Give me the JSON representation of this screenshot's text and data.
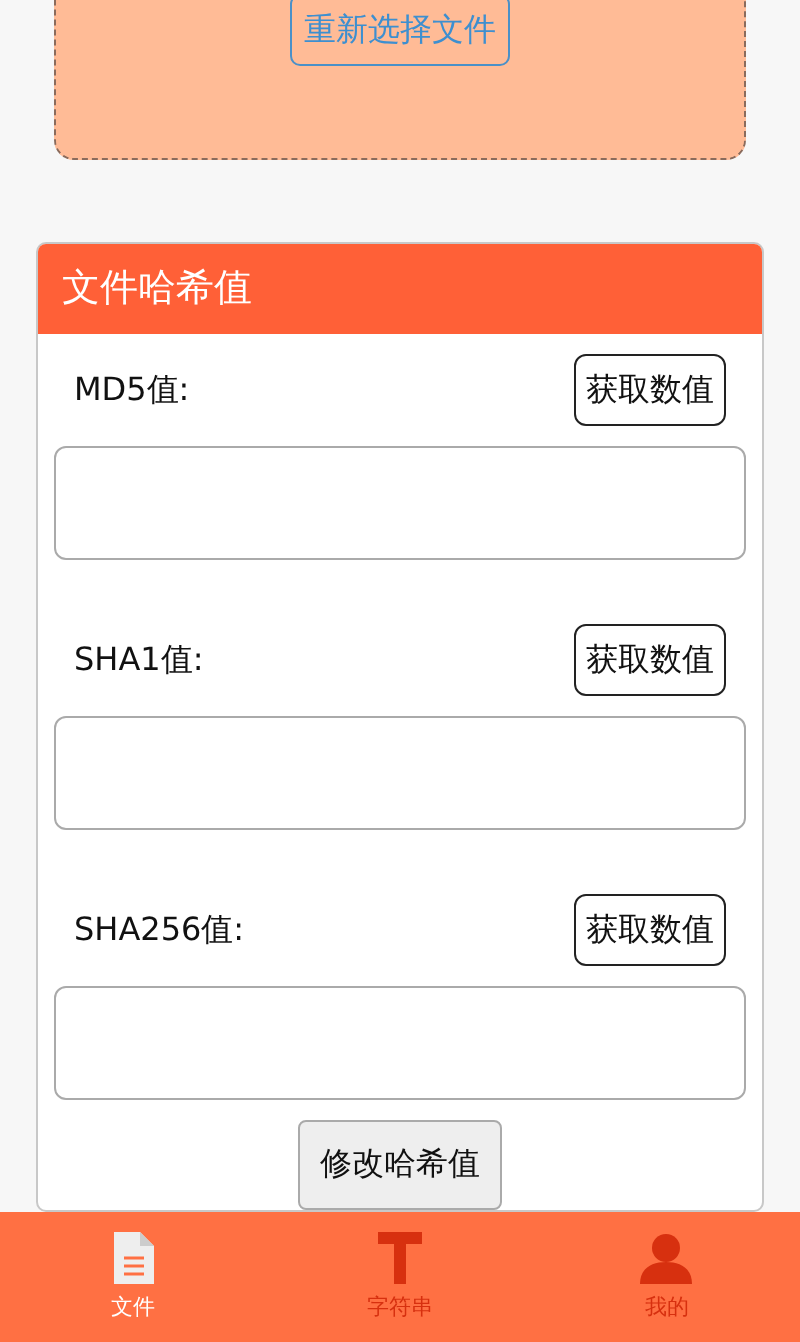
{
  "file_picker": {
    "button": "重新选择文件"
  },
  "hash_card": {
    "title": "文件哈希值",
    "rows": [
      {
        "label": "MD5值:",
        "button": "获取数值",
        "value": ""
      },
      {
        "label": "SHA1值:",
        "button": "获取数值",
        "value": ""
      },
      {
        "label": "SHA256值:",
        "button": "获取数值",
        "value": ""
      }
    ],
    "modify_button": "修改哈希值"
  },
  "tab_bar": [
    {
      "label": "文件",
      "kind": "file",
      "selected": true
    },
    {
      "label": "字符串",
      "kind": "text",
      "selected": false
    },
    {
      "label": "我的",
      "kind": "user",
      "selected": false
    }
  ]
}
